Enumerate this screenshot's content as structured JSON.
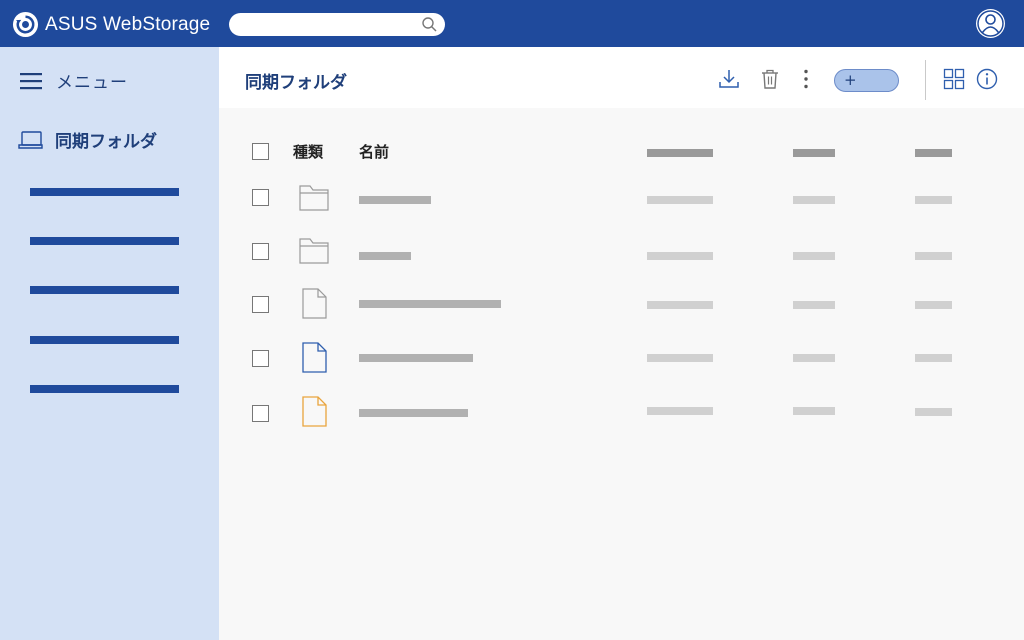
{
  "app": {
    "brand_name": "ASUS WebStorage",
    "colors": {
      "brand": "#1f4a9c",
      "sidebar": "#d4e1f5",
      "accent_button": "#aac3ea",
      "doc_icon": "#2f5fae",
      "doc_icon_orange": "#e9a43d"
    }
  },
  "topbar": {
    "search": {
      "value": "",
      "placeholder": "",
      "icon": "search-icon"
    },
    "avatar_icon": "user-icon"
  },
  "sidebar": {
    "menu_label": "メニュー",
    "menu_icon": "hamburger-icon",
    "sync_folder_label": "同期フォルダ",
    "sync_folder_icon": "laptop-icon",
    "items": [
      {
        "label": ""
      },
      {
        "label": ""
      },
      {
        "label": ""
      },
      {
        "label": ""
      },
      {
        "label": ""
      }
    ]
  },
  "header": {
    "title": "同期フォルダ",
    "toolbar": {
      "download_icon": "download-icon",
      "delete_icon": "trash-icon",
      "more_icon": "more-vertical-icon",
      "new_button_label": "+",
      "grid_view_icon": "grid-view-icon",
      "info_icon": "info-icon"
    }
  },
  "file_list": {
    "columns": {
      "type": "種類",
      "name": "名前"
    },
    "rows": [
      {
        "type": "folder",
        "icon": "folder-icon",
        "name": ""
      },
      {
        "type": "folder",
        "icon": "folder-icon",
        "name": ""
      },
      {
        "type": "file",
        "icon": "file-icon",
        "name": ""
      },
      {
        "type": "file",
        "icon": "file-blue-icon",
        "name": ""
      },
      {
        "type": "file",
        "icon": "file-orange-icon",
        "name": ""
      }
    ]
  }
}
